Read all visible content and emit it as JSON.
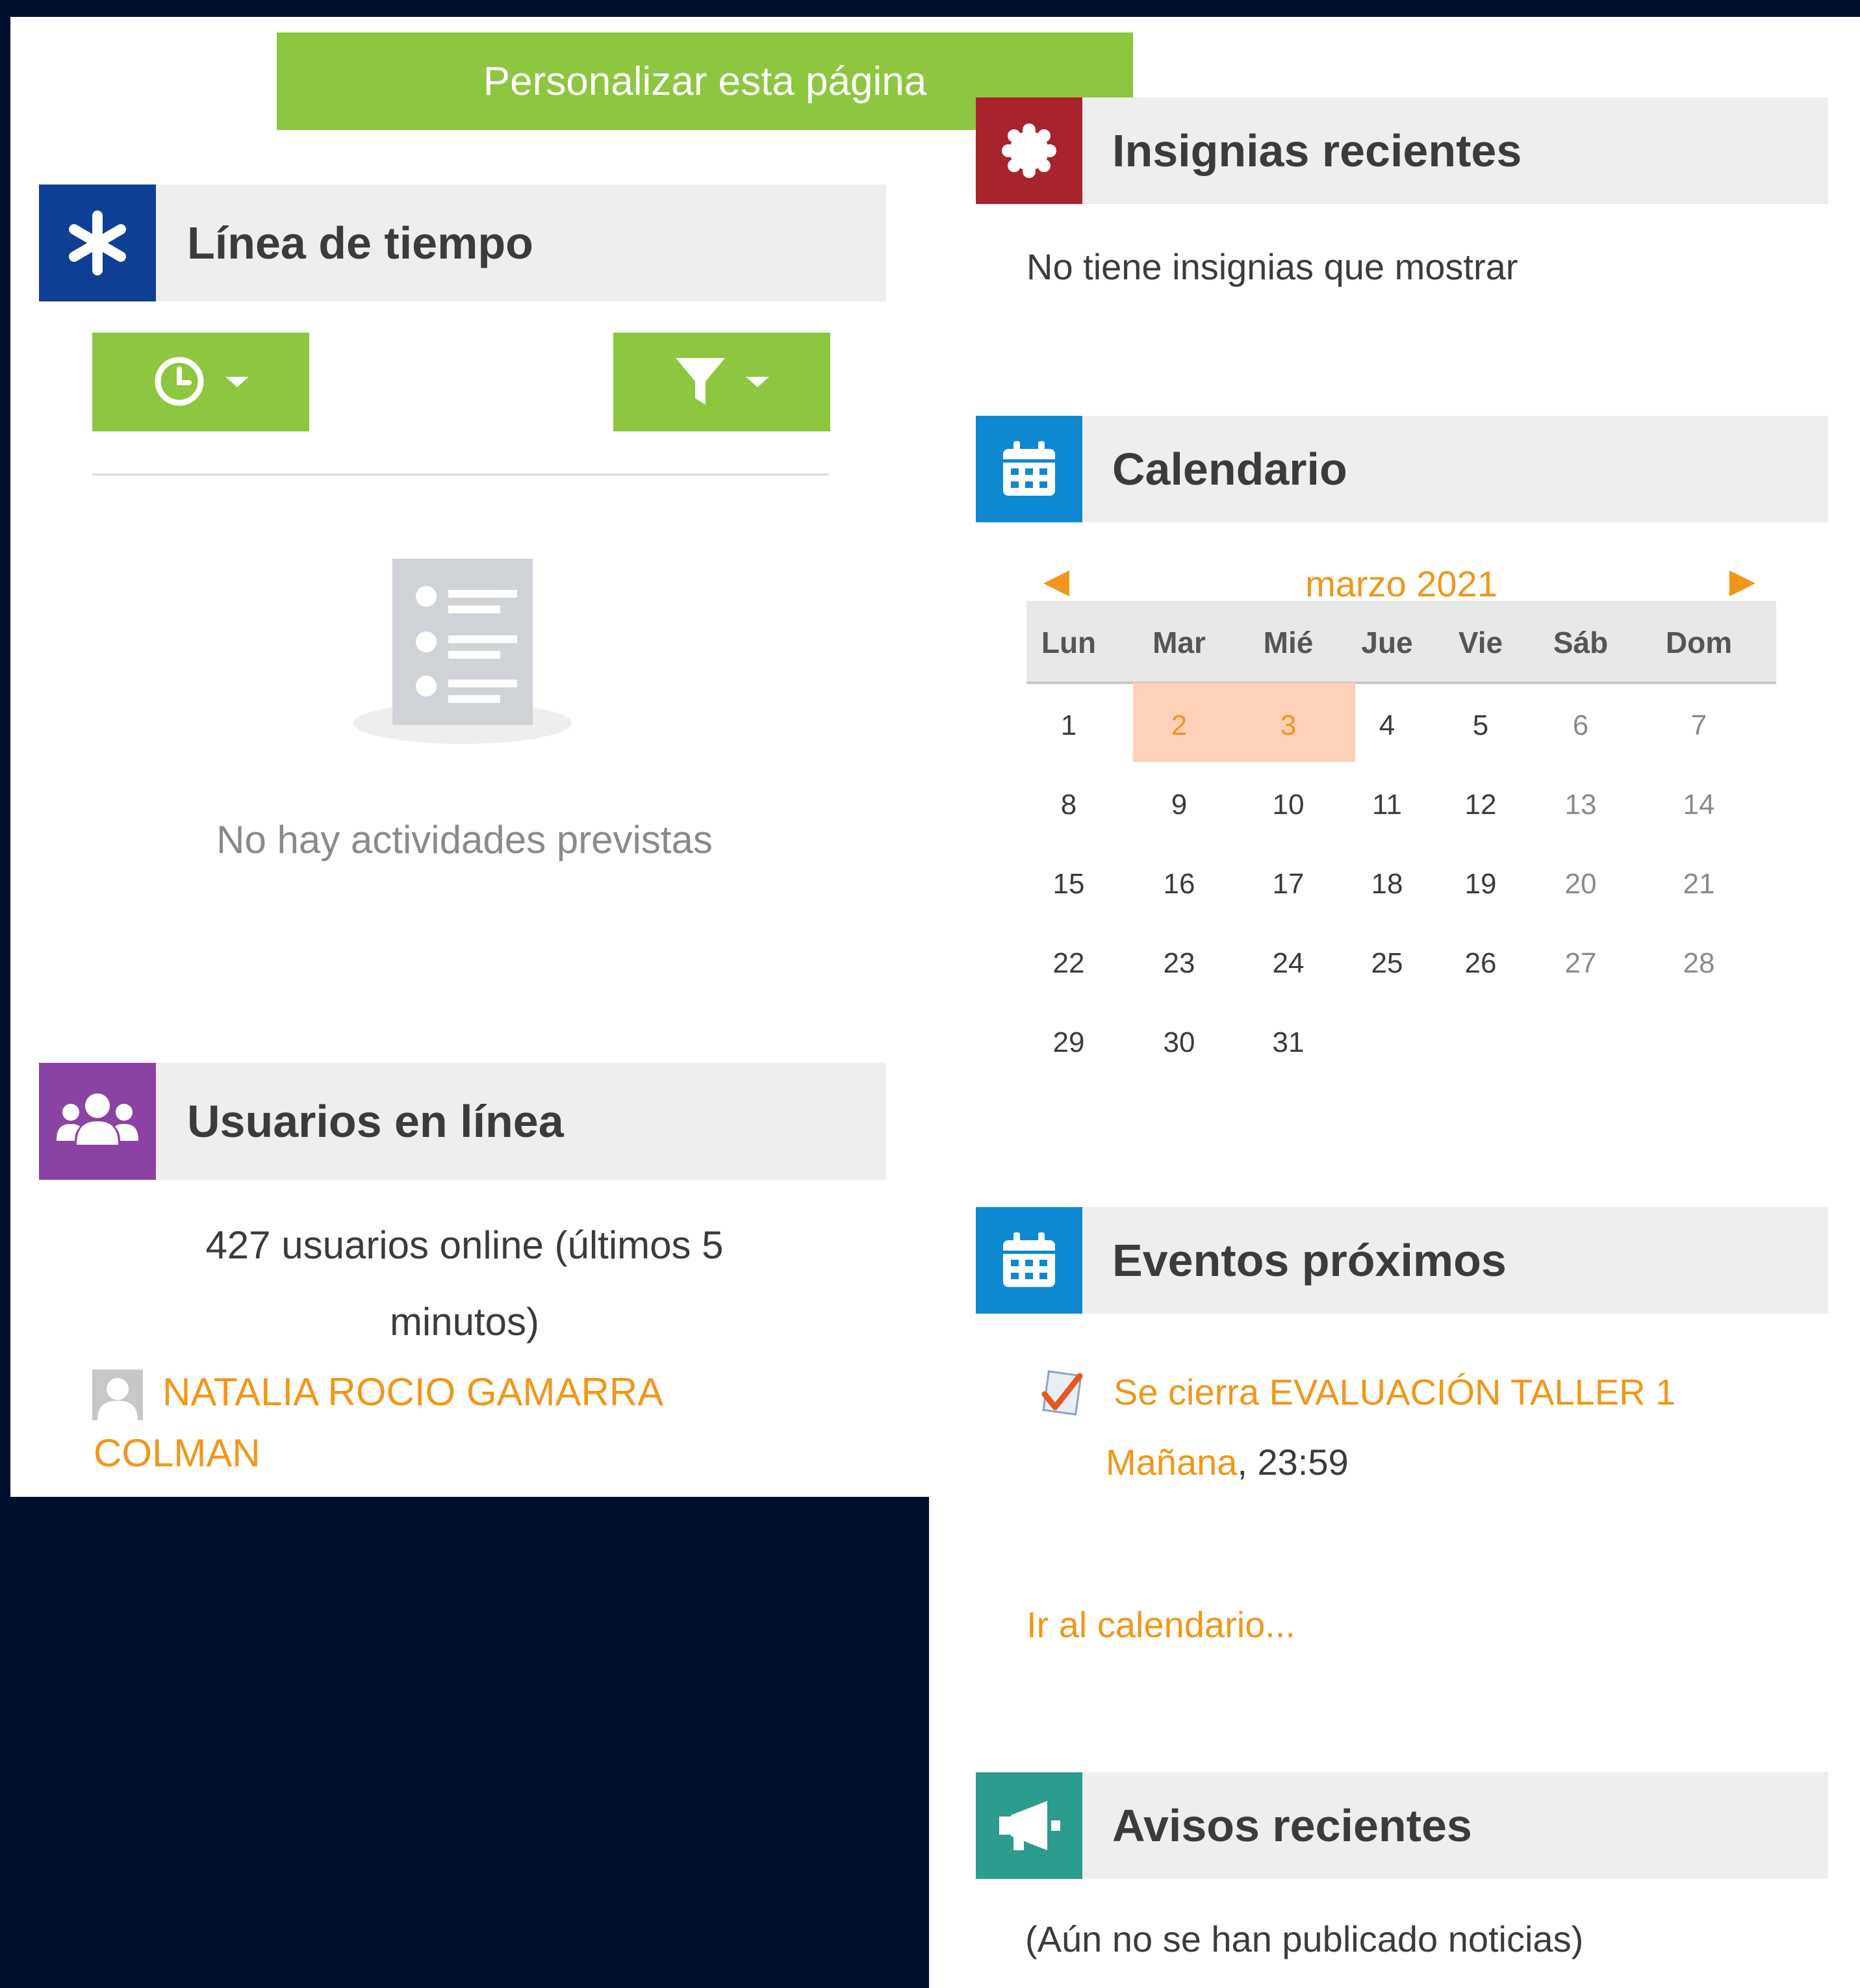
{
  "customize_button": "Personalizar esta página",
  "timeline": {
    "title": "Línea de tiempo",
    "empty_text": "No hay actividades previstas"
  },
  "online_users": {
    "title": "Usuarios en línea",
    "summary_line1": "427 usuarios online (últimos 5",
    "summary_line2": "minutos)",
    "user_name_line1": "NATALIA ROCIO GAMARRA",
    "user_name_line2": "COLMAN"
  },
  "badges": {
    "title": "Insignias recientes",
    "empty_text": "No tiene insignias que mostrar"
  },
  "calendar": {
    "title": "Calendario",
    "month": "marzo 2021",
    "day_names": [
      "Lun",
      "Mar",
      "Mié",
      "Jue",
      "Vie",
      "Sáb",
      "Dom"
    ],
    "weeks": [
      [
        "1",
        "2",
        "3",
        "4",
        "5",
        "6",
        "7"
      ],
      [
        "8",
        "9",
        "10",
        "11",
        "12",
        "13",
        "14"
      ],
      [
        "15",
        "16",
        "17",
        "18",
        "19",
        "20",
        "21"
      ],
      [
        "22",
        "23",
        "24",
        "25",
        "26",
        "27",
        "28"
      ],
      [
        "29",
        "30",
        "31",
        "",
        "",
        "",
        ""
      ]
    ],
    "highlighted_days": [
      "2",
      "3"
    ]
  },
  "upcoming_events": {
    "title": "Eventos próximos",
    "event_title": "Se cierra EVALUACIÓN TALLER 1",
    "event_day": "Mañana",
    "event_time": ", 23:59",
    "goto_calendar": "Ir al calendario..."
  },
  "news": {
    "title": "Avisos recientes",
    "empty_text": "(Aún no se han publicado noticias)"
  },
  "colors": {
    "green": "#8dc63f",
    "timeline_blue": "#0f3f95",
    "users_purple": "#8b43a3",
    "badges_red": "#a8232b",
    "calendar_blue": "#0f88d2",
    "news_teal": "#2b9c8e",
    "link_orange": "#f0971b",
    "today_highlight": "#fdd0b7"
  }
}
